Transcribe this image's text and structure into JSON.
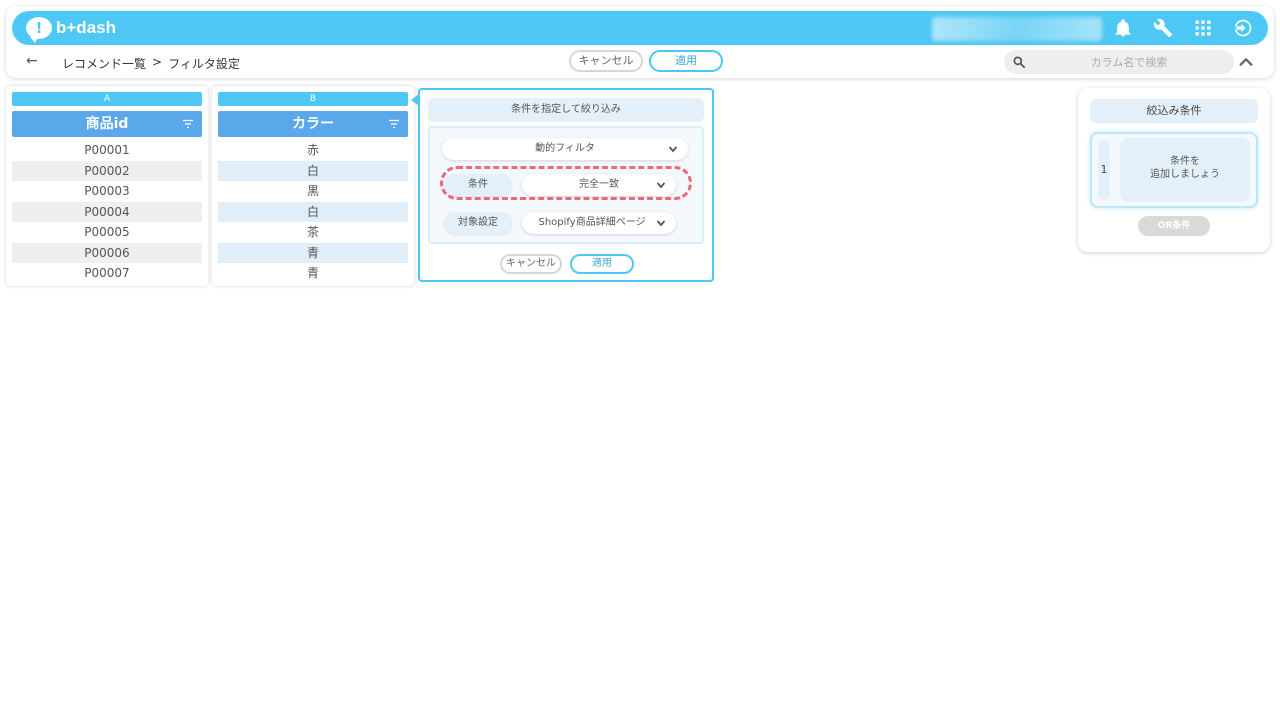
{
  "header": {
    "logo_text": "b+dash",
    "logo_mark": "!",
    "icons": [
      "bell-icon",
      "wrench-icon",
      "grid-icon",
      "logout-icon"
    ]
  },
  "subbar": {
    "back": "←",
    "breadcrumb": [
      "レコメンド一覧",
      ">",
      "フィルタ設定"
    ],
    "cancel_label": "キャンセル",
    "apply_label": "適用",
    "search_placeholder": "カラム名で検索"
  },
  "columns": [
    {
      "letter": "A",
      "header": "商品id",
      "rows": [
        "P00001",
        "P00002",
        "P00003",
        "P00004",
        "P00005",
        "P00006",
        "P00007"
      ]
    },
    {
      "letter": "B",
      "header": "カラー",
      "rows": [
        "赤",
        "白",
        "黒",
        "白",
        "茶",
        "青",
        "青"
      ]
    }
  ],
  "filter_panel": {
    "title": "条件を指定して絞り込み",
    "filter_type": "動的フィルタ",
    "condition_label": "条件",
    "condition_value": "完全一致",
    "target_label": "対象設定",
    "target_value": "Shopify商品詳細ページ",
    "cancel_label": "キャンセル",
    "apply_label": "適用"
  },
  "conditions_panel": {
    "title": "絞込み条件",
    "group_number": "1",
    "add_line1": "条件を",
    "add_line2": "追加しましょう",
    "or_label": "OR条件"
  },
  "colors": {
    "brand": "#4dc7f4",
    "column_header": "#5aa7ea",
    "highlight_dash": "#ea6a79"
  }
}
